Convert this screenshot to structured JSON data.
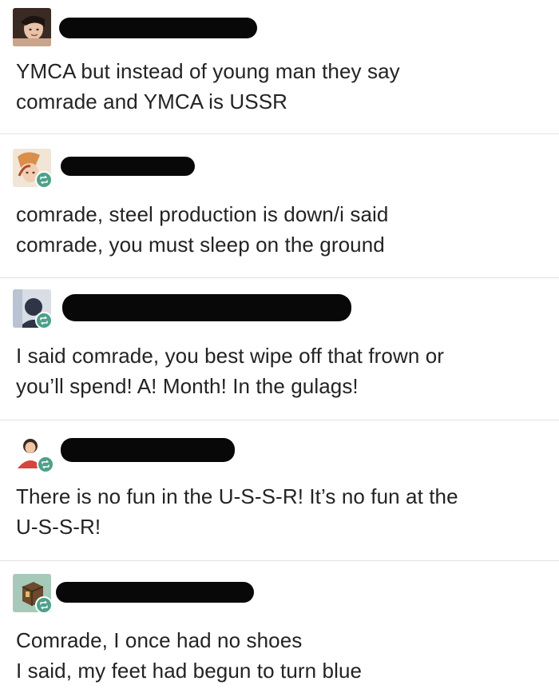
{
  "accent_colors": {
    "reblog_badge": "#4ea08a",
    "redaction": "#080808",
    "divider": "#e2e2e2"
  },
  "posts": [
    {
      "avatar_icon": "user-avatar-icon",
      "lines": [
        "YMCA but instead of young man they say",
        "comrade and YMCA is USSR"
      ]
    },
    {
      "avatar_icon": "user-avatar-icon",
      "badge_icon": "reblog-icon",
      "lines": [
        "comrade, steel production is down/i said",
        "comrade, you must sleep on the ground"
      ]
    },
    {
      "avatar_icon": "user-avatar-icon",
      "badge_icon": "reblog-icon",
      "lines": [
        "I said comrade, you best wipe off that frown or",
        "you’ll spend! A! Month! In the gulags!"
      ]
    },
    {
      "avatar_icon": "user-avatar-icon",
      "badge_icon": "reblog-icon",
      "lines": [
        "There is no fun in the U-S-S-R! It’s no fun at the",
        "U-S-S-R!"
      ]
    },
    {
      "avatar_icon": "user-avatar-icon",
      "badge_icon": "reblog-icon",
      "lines": [
        "Comrade, I once had no shoes",
        "I said, my feet had begun to turn blue"
      ]
    }
  ]
}
